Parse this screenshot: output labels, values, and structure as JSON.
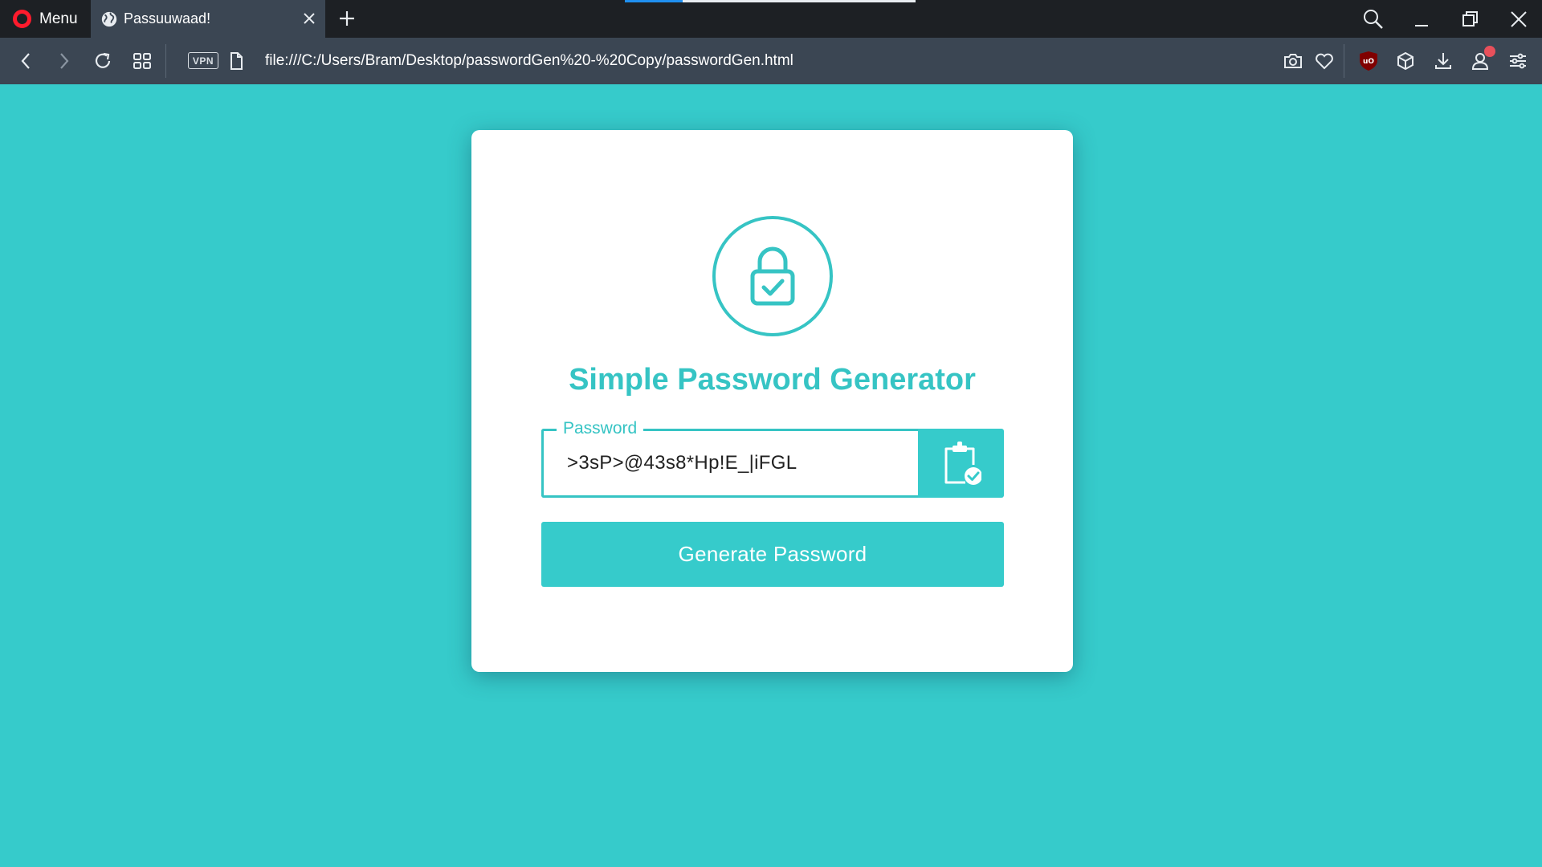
{
  "browser": {
    "menu_label": "Menu",
    "tab_title": "Passuuwaad!",
    "url": "file:///C:/Users/Bram/Desktop/passwordGen%20-%20Copy/passwordGen.html",
    "vpn_label": "VPN",
    "accent_color": "#1f8ff0",
    "icons": [
      "opera-logo",
      "globe-icon",
      "close-tab-icon",
      "new-tab-icon",
      "search-icon",
      "minimize-icon",
      "restore-icon",
      "close-window-icon",
      "back-icon",
      "forward-icon",
      "reload-icon",
      "speed-dial-icon",
      "page-icon",
      "camera-icon",
      "heart-icon",
      "ublock-icon",
      "cube-icon",
      "download-icon",
      "account-icon",
      "easy-setup-icon"
    ]
  },
  "page": {
    "background_color": "#36cbcb",
    "title": "Simple Password Generator",
    "password_label": "Password",
    "password_value": ">3sP>@43s8*Hp!E_|iFGL",
    "generate_label": "Generate Password",
    "accent_color": "#36c4c4",
    "icons": [
      "lock-check-icon",
      "clipboard-check-icon"
    ]
  }
}
